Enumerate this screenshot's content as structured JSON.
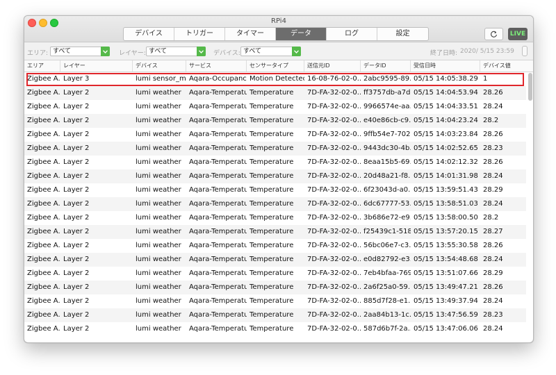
{
  "window": {
    "title": "RPi4"
  },
  "tabs": [
    {
      "label": "デバイス"
    },
    {
      "label": "トリガー"
    },
    {
      "label": "タイマー"
    },
    {
      "label": "データ"
    },
    {
      "label": "ログ"
    },
    {
      "label": "設定"
    }
  ],
  "active_tab": "データ",
  "toolbar": {
    "live_label": "LIVE",
    "refresh_icon": "refresh-icon"
  },
  "filters": {
    "area_label": "エリア:",
    "area_value": "すべて",
    "layer_label": "レイヤー:",
    "layer_value": "すべて",
    "device_label": "デバイス:",
    "device_value": "すべて",
    "end_date_label": "終了日時:",
    "end_date_value": "2020/  5/15 23:59"
  },
  "columns": [
    "エリア",
    "レイヤー",
    "デバイス",
    "サービス",
    "センサータイプ",
    "送信元ID",
    "データID",
    "受信日時",
    "デバイス値"
  ],
  "rows": [
    [
      "Zigbee A...",
      "Layer 3",
      "lumi sensor_mo...",
      "Aqara-Occupancy",
      "Motion Detected",
      "16-08-76-02-0...",
      "2abc9595-89...",
      "05/15 14:05:38.29",
      "1"
    ],
    [
      "Zigbee A...",
      "Layer 2",
      "lumi weather",
      "Aqara-Temperature",
      "Temperature",
      "7D-FA-32-02-0...",
      "ff3757db-a7d...",
      "05/15 14:04:53.94",
      "28.26"
    ],
    [
      "Zigbee A...",
      "Layer 2",
      "lumi weather",
      "Aqara-Temperature",
      "Temperature",
      "7D-FA-32-02-0...",
      "9966574e-aa...",
      "05/15 14:04:33.51",
      "28.24"
    ],
    [
      "Zigbee A...",
      "Layer 2",
      "lumi weather",
      "Aqara-Temperature",
      "Temperature",
      "7D-FA-32-02-0...",
      "e40e86cb-c9...",
      "05/15 14:04:23.24",
      "28.2"
    ],
    [
      "Zigbee A...",
      "Layer 2",
      "lumi weather",
      "Aqara-Temperature",
      "Temperature",
      "7D-FA-32-02-0...",
      "9ffb54e7-702...",
      "05/15 14:03:23.84",
      "28.26"
    ],
    [
      "Zigbee A...",
      "Layer 2",
      "lumi weather",
      "Aqara-Temperature",
      "Temperature",
      "7D-FA-32-02-0...",
      "9443dc30-4b...",
      "05/15 14:02:52.65",
      "28.23"
    ],
    [
      "Zigbee A...",
      "Layer 2",
      "lumi weather",
      "Aqara-Temperature",
      "Temperature",
      "7D-FA-32-02-0...",
      "8eaa15b5-69...",
      "05/15 14:02:12.32",
      "28.26"
    ],
    [
      "Zigbee A...",
      "Layer 2",
      "lumi weather",
      "Aqara-Temperature",
      "Temperature",
      "7D-FA-32-02-0...",
      "20d48a21-f8...",
      "05/15 14:01:31.98",
      "28.24"
    ],
    [
      "Zigbee A...",
      "Layer 2",
      "lumi weather",
      "Aqara-Temperature",
      "Temperature",
      "7D-FA-32-02-0...",
      "6f23043d-a0...",
      "05/15 13:59:51.43",
      "28.29"
    ],
    [
      "Zigbee A...",
      "Layer 2",
      "lumi weather",
      "Aqara-Temperature",
      "Temperature",
      "7D-FA-32-02-0...",
      "6dc67777-53...",
      "05/15 13:58:51.03",
      "28.24"
    ],
    [
      "Zigbee A...",
      "Layer 2",
      "lumi weather",
      "Aqara-Temperature",
      "Temperature",
      "7D-FA-32-02-0...",
      "3b686e72-e9...",
      "05/15 13:58:00.50",
      "28.2"
    ],
    [
      "Zigbee A...",
      "Layer 2",
      "lumi weather",
      "Aqara-Temperature",
      "Temperature",
      "7D-FA-32-02-0...",
      "f25439c1-518...",
      "05/15 13:57:20.15",
      "28.27"
    ],
    [
      "Zigbee A...",
      "Layer 2",
      "lumi weather",
      "Aqara-Temperature",
      "Temperature",
      "7D-FA-32-02-0...",
      "56bc06e7-c3...",
      "05/15 13:55:30.58",
      "28.26"
    ],
    [
      "Zigbee A...",
      "Layer 2",
      "lumi weather",
      "Aqara-Temperature",
      "Temperature",
      "7D-FA-32-02-0...",
      "e0d82792-e3...",
      "05/15 13:54:48.68",
      "28.24"
    ],
    [
      "Zigbee A...",
      "Layer 2",
      "lumi weather",
      "Aqara-Temperature",
      "Temperature",
      "7D-FA-32-02-0...",
      "7eb4bfaa-769...",
      "05/15 13:51:07.66",
      "28.29"
    ],
    [
      "Zigbee A...",
      "Layer 2",
      "lumi weather",
      "Aqara-Temperature",
      "Temperature",
      "7D-FA-32-02-0...",
      "2a6f25a0-59...",
      "05/15 13:49:47.21",
      "28.26"
    ],
    [
      "Zigbee A...",
      "Layer 2",
      "lumi weather",
      "Aqara-Temperature",
      "Temperature",
      "7D-FA-32-02-0...",
      "885d7f28-e1...",
      "05/15 13:49:37.94",
      "28.24"
    ],
    [
      "Zigbee A...",
      "Layer 2",
      "lumi weather",
      "Aqara-Temperature",
      "Temperature",
      "7D-FA-32-02-0...",
      "2aa84b13-1c...",
      "05/15 13:47:56.59",
      "28.23"
    ],
    [
      "Zigbee A...",
      "Layer 2",
      "lumi weather",
      "Aqara-Temperature",
      "Temperature",
      "7D-FA-32-02-0...",
      "587d6b7f-2a...",
      "05/15 13:47:06.06",
      "28.24"
    ]
  ],
  "colors": {
    "accent_green": "#55b94a",
    "live_green": "#7cf07a",
    "highlight_red": "#e0262b",
    "active_tab": "#6d6d6d"
  }
}
